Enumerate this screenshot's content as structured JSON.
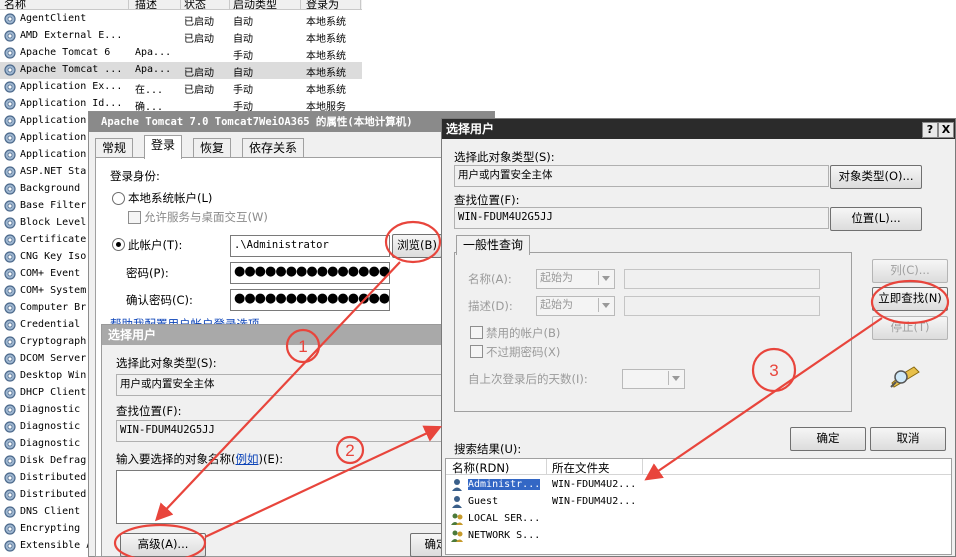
{
  "services": {
    "columns": [
      "名称",
      "描述",
      "状态",
      "启动类型",
      "登录为"
    ],
    "rows": [
      {
        "name": "AgentClient",
        "desc": "",
        "state": "已启动",
        "startup": "自动",
        "logon": "本地系统"
      },
      {
        "name": "AMD External E...",
        "desc": "",
        "state": "已启动",
        "startup": "自动",
        "logon": "本地系统"
      },
      {
        "name": "Apache Tomcat 6",
        "desc": "Apa...",
        "state": "",
        "startup": "手动",
        "logon": "本地系统"
      },
      {
        "name": "Apache Tomcat ...",
        "desc": "Apa...",
        "state": "已启动",
        "startup": "自动",
        "logon": "本地系统"
      },
      {
        "name": "Application Ex...",
        "desc": "在...",
        "state": "已启动",
        "startup": "手动",
        "logon": "本地系统"
      },
      {
        "name": "Application Id...",
        "desc": "确...",
        "state": "",
        "startup": "手动",
        "logon": "本地服务"
      },
      {
        "name": "Application",
        "desc": "",
        "state": "",
        "startup": "",
        "logon": ""
      },
      {
        "name": "Application",
        "desc": "",
        "state": "",
        "startup": "",
        "logon": ""
      },
      {
        "name": "Application",
        "desc": "",
        "state": "",
        "startup": "",
        "logon": ""
      },
      {
        "name": "ASP.NET Sta",
        "desc": "",
        "state": "",
        "startup": "",
        "logon": ""
      },
      {
        "name": "Background",
        "desc": "",
        "state": "",
        "startup": "",
        "logon": ""
      },
      {
        "name": "Base Filter",
        "desc": "",
        "state": "",
        "startup": "",
        "logon": ""
      },
      {
        "name": "Block Level",
        "desc": "",
        "state": "",
        "startup": "",
        "logon": ""
      },
      {
        "name": "Certificate",
        "desc": "",
        "state": "",
        "startup": "",
        "logon": ""
      },
      {
        "name": "CNG Key Iso",
        "desc": "",
        "state": "",
        "startup": "",
        "logon": ""
      },
      {
        "name": "COM+ Event",
        "desc": "",
        "state": "",
        "startup": "",
        "logon": ""
      },
      {
        "name": "COM+ System",
        "desc": "",
        "state": "",
        "startup": "",
        "logon": ""
      },
      {
        "name": "Computer Br",
        "desc": "",
        "state": "",
        "startup": "",
        "logon": ""
      },
      {
        "name": "Credential",
        "desc": "",
        "state": "",
        "startup": "",
        "logon": ""
      },
      {
        "name": "Cryptograph",
        "desc": "",
        "state": "",
        "startup": "",
        "logon": ""
      },
      {
        "name": "DCOM Server",
        "desc": "",
        "state": "",
        "startup": "",
        "logon": ""
      },
      {
        "name": "Desktop Win",
        "desc": "",
        "state": "",
        "startup": "",
        "logon": ""
      },
      {
        "name": "DHCP Client",
        "desc": "",
        "state": "",
        "startup": "",
        "logon": ""
      },
      {
        "name": "Diagnostic",
        "desc": "",
        "state": "",
        "startup": "",
        "logon": ""
      },
      {
        "name": "Diagnostic",
        "desc": "",
        "state": "",
        "startup": "",
        "logon": ""
      },
      {
        "name": "Diagnostic",
        "desc": "",
        "state": "",
        "startup": "",
        "logon": ""
      },
      {
        "name": "Disk Defrag",
        "desc": "",
        "state": "",
        "startup": "",
        "logon": ""
      },
      {
        "name": "Distributed",
        "desc": "",
        "state": "",
        "startup": "",
        "logon": ""
      },
      {
        "name": "Distributed",
        "desc": "",
        "state": "",
        "startup": "",
        "logon": ""
      },
      {
        "name": "DNS Client",
        "desc": "",
        "state": "",
        "startup": "",
        "logon": ""
      },
      {
        "name": "Encrypting",
        "desc": "",
        "state": "",
        "startup": "",
        "logon": ""
      },
      {
        "name": "Extensible Au",
        "desc": "",
        "state": "",
        "startup": "",
        "logon": ""
      }
    ],
    "selected_index": 3
  },
  "props": {
    "title": "Apache Tomcat 7.0 Tomcat7WeiOA365 的属性(本地计算机)",
    "tabs": [
      "常规",
      "登录",
      "恢复",
      "依存关系"
    ],
    "active_tab": "登录",
    "logon_as": "登录身份:",
    "local_system": "本地系统帐户(L)",
    "allow_desktop": "允许服务与桌面交互(W)",
    "this_account": "此帐户(T):",
    "account_value": ".\\Administrator",
    "browse": "浏览(B)",
    "password": "密码(P):",
    "confirm_password": "确认密码(C):",
    "password_mask": "●●●●●●●●●●●●●●●",
    "help_link": "帮助我配置用户帐户登录选项。"
  },
  "select_small": {
    "title": "选择用户",
    "object_type_label": "选择此对象类型(S):",
    "object_type_value": "用户或内置安全主体",
    "location_label": "查找位置(F):",
    "location_value": "WIN-FDUM4U2G5JJ",
    "enter_names_label": "输入要选择的对象名称",
    "examples_link": "例如",
    "enter_names_suffix": "(E):",
    "advanced": "高级(A)...",
    "ok": "确定"
  },
  "select_big": {
    "title": "选择用户",
    "help_btn": "?",
    "close_btn": "X",
    "object_type_label": "选择此对象类型(S):",
    "object_type_value": "用户或内置安全主体",
    "object_types_btn": "对象类型(O)...",
    "location_label": "查找位置(F):",
    "location_value": "WIN-FDUM4U2G5JJ",
    "locations_btn": "位置(L)...",
    "tab": "一般性查询",
    "name_label": "名称(A):",
    "name_op": "起始为",
    "desc_label": "描述(D):",
    "desc_op": "起始为",
    "disabled_accounts": "禁用的帐户(B)",
    "non_expiring": "不过期密码(X)",
    "days_since": "自上次登录后的天数(I):",
    "columns_btn": "列(C)...",
    "find_now_btn": "立即查找(N)",
    "stop_btn": "停止(T)",
    "ok": "确定",
    "cancel": "取消",
    "results_label": "搜索结果(U):",
    "results_columns": [
      "名称(RDN)",
      "所在文件夹"
    ],
    "results": [
      {
        "name": "Administr...",
        "folder": "WIN-FDUM4U2...",
        "icon": "user-icon"
      },
      {
        "name": "Guest",
        "folder": "WIN-FDUM4U2...",
        "icon": "user-icon"
      },
      {
        "name": "LOCAL SER...",
        "folder": "",
        "icon": "group-icon"
      },
      {
        "name": "NETWORK S...",
        "folder": "",
        "icon": "group-icon"
      }
    ]
  },
  "annotations": {
    "labels": [
      "1",
      "2",
      "3"
    ],
    "color": "#e8453c"
  }
}
